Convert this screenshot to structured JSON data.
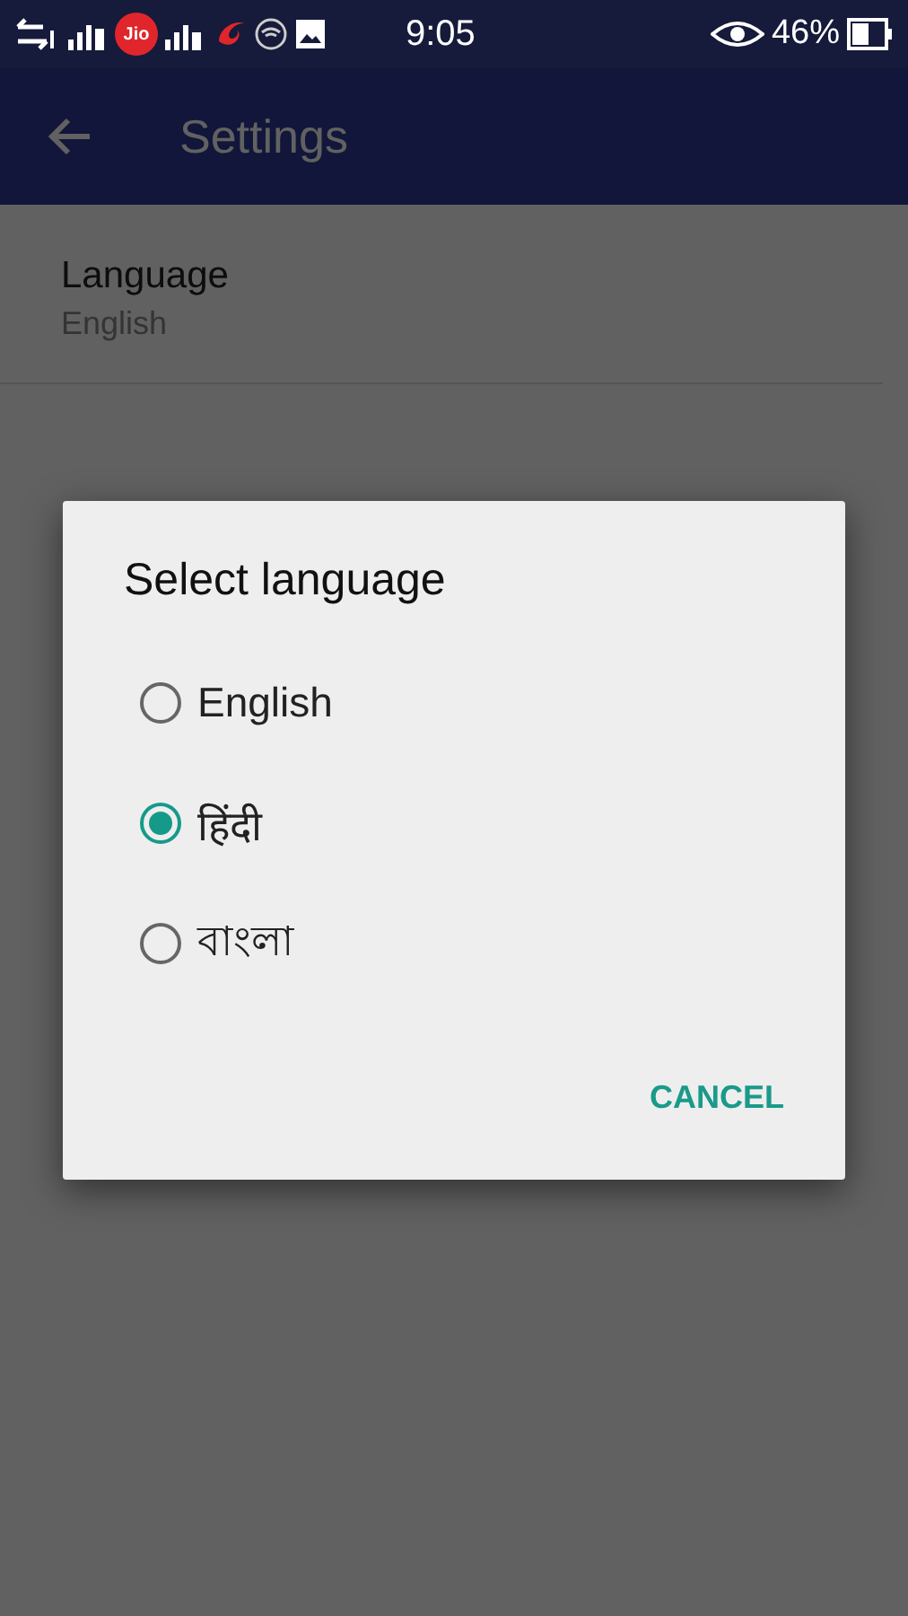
{
  "status_bar": {
    "carrier_logo": "Jio",
    "time": "9:05",
    "battery": "46%"
  },
  "app_bar": {
    "title": "Settings"
  },
  "settings": [
    {
      "title": "Language",
      "value": "English"
    }
  ],
  "dialog": {
    "title": "Select language",
    "options": [
      {
        "label": "English",
        "selected": false
      },
      {
        "label": "हिंदी",
        "selected": true
      },
      {
        "label": "বাংলা",
        "selected": false
      }
    ],
    "buttons": [
      "CANCEL"
    ]
  }
}
